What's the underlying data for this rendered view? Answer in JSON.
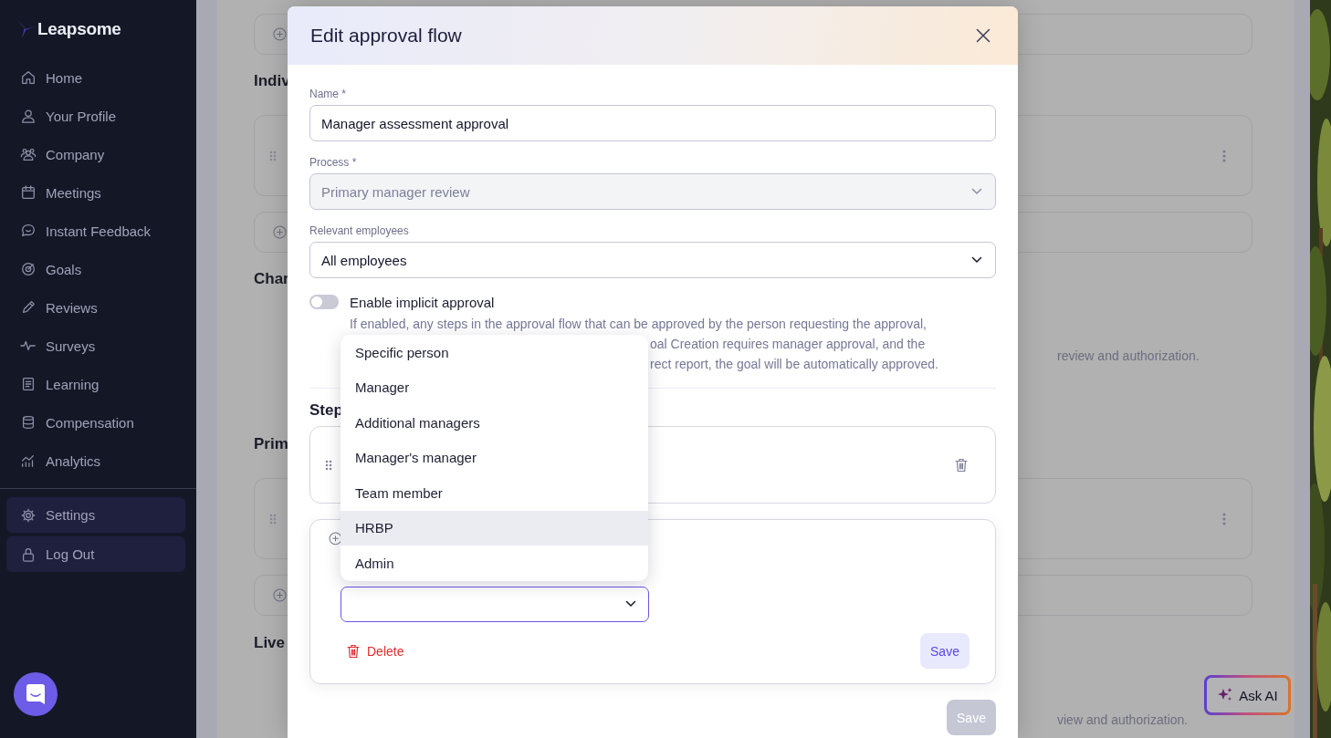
{
  "sidebar": {
    "logo": "Leapsome",
    "items": [
      {
        "label": "Home"
      },
      {
        "label": "Your Profile"
      },
      {
        "label": "Company"
      },
      {
        "label": "Meetings"
      },
      {
        "label": "Instant Feedback"
      },
      {
        "label": "Goals"
      },
      {
        "label": "Reviews"
      },
      {
        "label": "Surveys"
      },
      {
        "label": "Learning"
      },
      {
        "label": "Compensation"
      },
      {
        "label": "Analytics"
      }
    ],
    "footer_items": [
      {
        "label": "Settings"
      },
      {
        "label": "Log Out"
      }
    ]
  },
  "background_page": {
    "blocks": [
      {
        "kind": "add_card"
      },
      {
        "kind": "heading",
        "text": "Indiv"
      },
      {
        "kind": "item_card"
      },
      {
        "kind": "add_card"
      },
      {
        "kind": "heading",
        "text": "Char"
      },
      {
        "kind": "text",
        "text": "review and authorization."
      },
      {
        "kind": "heading",
        "text": "Prim"
      },
      {
        "kind": "item_card"
      },
      {
        "kind": "add_card"
      },
      {
        "kind": "heading",
        "text": "Live"
      },
      {
        "kind": "text",
        "text": "view and authorization."
      }
    ]
  },
  "modal": {
    "title": "Edit approval flow",
    "fields": [
      {
        "kind": "text",
        "label": "Name *",
        "value": "Manager assessment approval",
        "disabled": false
      },
      {
        "kind": "select",
        "label": "Process *",
        "value": "Primary manager review",
        "disabled": true
      },
      {
        "kind": "select",
        "label": "Relevant employees",
        "value": "All employees",
        "disabled": false
      }
    ],
    "toggle": {
      "label": "Enable implicit approval",
      "on": false,
      "description": [
        "If enabled, any steps in the approval flow that can be approved by the person requesting the approval,",
        "oal Creation requires manager approval, and the",
        "rect report, the goal will be automatically approved."
      ]
    },
    "steps_heading": "Step",
    "new_step": {
      "delete": "Delete",
      "save": {
        "label": "Save",
        "disabled": false
      }
    },
    "dropdown": {
      "options": [
        {
          "label": "Specific person",
          "selected": false
        },
        {
          "label": "Manager",
          "selected": false
        },
        {
          "label": "Additional managers",
          "selected": false
        },
        {
          "label": "Manager's manager",
          "selected": false
        },
        {
          "label": "Team member",
          "selected": false
        },
        {
          "label": "HRBP",
          "selected": true
        },
        {
          "label": "Admin",
          "selected": false
        }
      ]
    },
    "save": {
      "label": "Save",
      "disabled": true
    }
  },
  "ask_ai": "Ask AI"
}
